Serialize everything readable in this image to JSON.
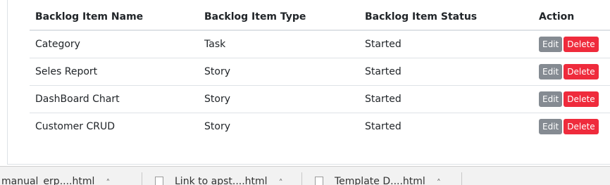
{
  "table": {
    "headers": {
      "name": "Backlog Item Name",
      "type": "Backlog Item Type",
      "status": "Backlog Item Status",
      "action": "Action"
    },
    "rows": [
      {
        "name": "Category",
        "type": "Task",
        "status": "Started"
      },
      {
        "name": "Seles Report",
        "type": "Story",
        "status": "Started"
      },
      {
        "name": "DashBoard Chart",
        "type": "Story",
        "status": "Started"
      },
      {
        "name": "Customer CRUD",
        "type": "Story",
        "status": "Started"
      }
    ],
    "edit_label": "Edit",
    "delete_label": "Delete"
  },
  "downloads": [
    {
      "name": "manual_erp....html"
    },
    {
      "name": "Link to apst....html"
    },
    {
      "name": "Template D....html"
    }
  ],
  "colors": {
    "edit": "#858b92",
    "delete": "#ef2b3c"
  }
}
